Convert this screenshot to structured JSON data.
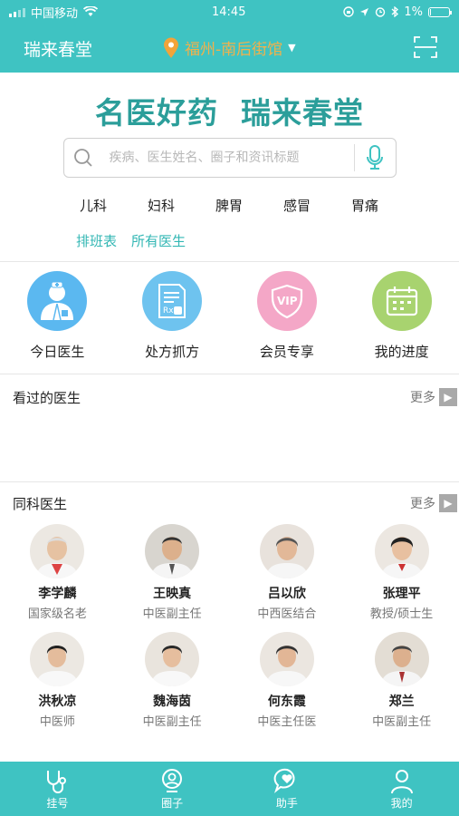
{
  "status": {
    "carrier": "中国移动",
    "time": "14:45",
    "battery": "1%",
    "battery_level": 0.05
  },
  "header": {
    "brand": "瑞来春堂",
    "location": "福州-南后街馆",
    "scan_icon": "scan-icon"
  },
  "slogan": "名医好药  瑞来春堂",
  "search": {
    "placeholder": "疾病、医生姓名、圈子和资讯标题"
  },
  "tags": [
    "儿科",
    "妇科",
    "脾胃",
    "感冒",
    "胃痛"
  ],
  "links": [
    "排班表",
    "所有医生"
  ],
  "features": [
    {
      "label": "今日医生",
      "icon": "doctor-icon",
      "color": "#5bb8f0"
    },
    {
      "label": "处方抓方",
      "icon": "prescription-icon",
      "color": "#6ec3ef"
    },
    {
      "label": "会员专享",
      "icon": "vip-icon",
      "color": "#f4a7c7"
    },
    {
      "label": "我的进度",
      "icon": "calendar-icon",
      "color": "#a8d36f"
    }
  ],
  "visited": {
    "title": "看过的医生",
    "more": "更多"
  },
  "same_dept": {
    "title": "同科医生",
    "more": "更多"
  },
  "doctors": [
    {
      "name": "李学麟",
      "title": "国家级名老"
    },
    {
      "name": "王映真",
      "title": "中医副主任"
    },
    {
      "name": "吕以欣",
      "title": "中西医结合"
    },
    {
      "name": "张理平",
      "title": "教授/硕士生"
    },
    {
      "name": "洪秋凉",
      "title": "中医师"
    },
    {
      "name": "魏海茵",
      "title": "中医副主任"
    },
    {
      "name": "何东霞",
      "title": "中医主任医"
    },
    {
      "name": "郑兰",
      "title": "中医副主任"
    }
  ],
  "tabs": [
    {
      "label": "挂号",
      "icon": "stethoscope-icon"
    },
    {
      "label": "圈子",
      "icon": "circle-group-icon"
    },
    {
      "label": "助手",
      "icon": "assistant-icon"
    },
    {
      "label": "我的",
      "icon": "person-icon"
    }
  ],
  "colors": {
    "primary": "#3fc3c2",
    "slogan": "#2b9e9a",
    "location": "#f2b14b",
    "link": "#33b7b4"
  }
}
